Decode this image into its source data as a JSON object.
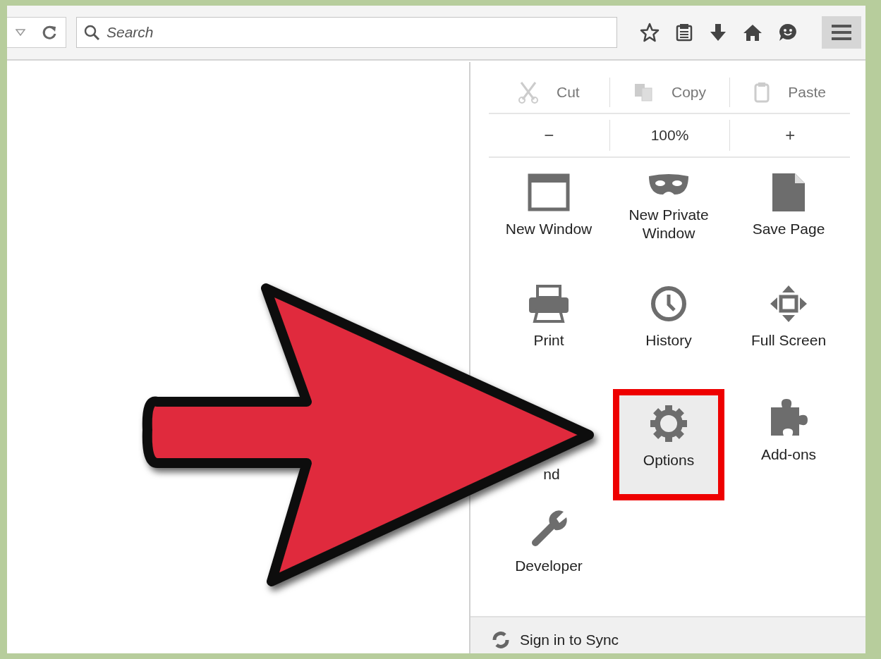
{
  "toolbar": {
    "search": {
      "placeholder": "Search"
    },
    "menu_button": {
      "open": true
    }
  },
  "menu": {
    "edit_row": [
      {
        "kind": "cut",
        "label": "Cut"
      },
      {
        "kind": "copy",
        "label": "Copy"
      },
      {
        "kind": "paste",
        "label": "Paste"
      }
    ],
    "zoom_row": {
      "decrease": "−",
      "level": "100%",
      "increase": "+"
    },
    "items": [
      {
        "kind": "new-window",
        "label": "New Window",
        "selected": false
      },
      {
        "kind": "private",
        "label": "New Private Window",
        "selected": false
      },
      {
        "kind": "save",
        "label": "Save Page",
        "selected": false
      },
      {
        "kind": "print",
        "label": "Print",
        "selected": false
      },
      {
        "kind": "history",
        "label": "History",
        "selected": false
      },
      {
        "kind": "fullscreen",
        "label": "Full Screen",
        "selected": false
      },
      {
        "kind": "find",
        "label": "nd",
        "selected": false
      },
      {
        "kind": "options",
        "label": "Options",
        "selected": true
      },
      {
        "kind": "addons",
        "label": "Add-ons",
        "selected": false
      },
      {
        "kind": "developer",
        "label": "Developer",
        "selected": false
      }
    ],
    "footer": {
      "label": "Sign in to Sync"
    }
  }
}
